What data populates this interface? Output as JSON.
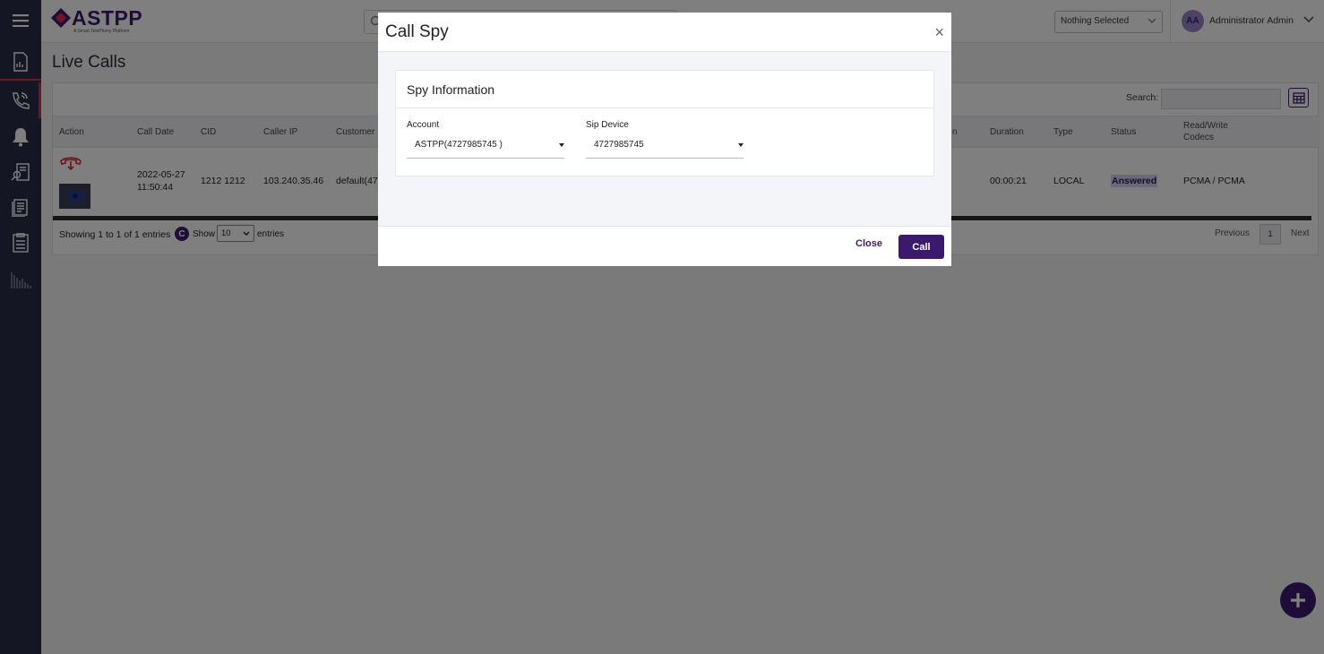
{
  "app": {
    "logo": "ASTPP",
    "tagline": "A Smart TelePhony Platform"
  },
  "header": {
    "filter_select": "Nothing Selected",
    "avatar_initials": "AA",
    "user_name": "Administrator Admin"
  },
  "page": {
    "title": "Live Calls"
  },
  "table": {
    "search_label": "Search:",
    "columns": [
      "Action",
      "Call Date",
      "CID",
      "Caller IP",
      "Customer",
      "n",
      "Duration",
      "Type",
      "Status",
      "Read/Write",
      "Codecs"
    ],
    "row": {
      "date_line1": "2022-05-27",
      "date_line2": "11:50:44",
      "cid": "1212 1212",
      "caller_ip": "103.240.35.46",
      "customer": "default(47",
      "duration": "00:00:21",
      "type": "LOCAL",
      "status": "Answered",
      "codecs": "PCMA / PCMA"
    },
    "info": "Showing 1 to 1 of 1 entries",
    "show_label": "Show",
    "page_size": "10",
    "entries_label": "entries",
    "prev": "Previous",
    "page": "1",
    "next": "Next"
  },
  "modal": {
    "title": "Call Spy",
    "close_x": "×",
    "section_title": "Spy Information",
    "account_label": "Account",
    "account_value": "ASTPP(4727985745 )",
    "sip_label": "Sip Device",
    "sip_value": "4727985745",
    "close_button": "Close",
    "call_button": "Call"
  },
  "colors": {
    "brand": "#3b1a6e",
    "sidebar": "#2b2c49",
    "accent_red": "#e5294a"
  },
  "icons": [
    "menu-icon",
    "dashboard-icon",
    "phone-icon",
    "bell-icon",
    "user-search-icon",
    "report-icon",
    "checklist-icon",
    "bar-chart-icon",
    "search-icon",
    "grid-icon",
    "hangup-icon",
    "eye-icon",
    "plus-icon"
  ]
}
